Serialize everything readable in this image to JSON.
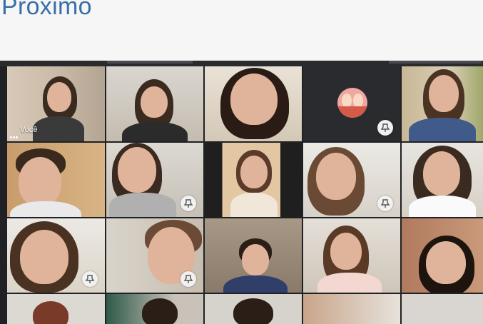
{
  "page": {
    "title": "Próximo"
  },
  "meet": {
    "self_label": "Você",
    "tiles": [
      {
        "id": "r1c1",
        "self": true
      },
      {
        "id": "r1c2"
      },
      {
        "id": "r1c3"
      },
      {
        "id": "r1c4",
        "avatar_only": true
      },
      {
        "id": "r1c5"
      },
      {
        "id": "r2c1"
      },
      {
        "id": "r2c2"
      },
      {
        "id": "r2c3"
      },
      {
        "id": "r2c4"
      },
      {
        "id": "r2c5"
      },
      {
        "id": "r3c1"
      },
      {
        "id": "r3c2"
      },
      {
        "id": "r3c3"
      },
      {
        "id": "r3c4"
      },
      {
        "id": "r3c5"
      },
      {
        "id": "r4c1"
      },
      {
        "id": "r4c2"
      },
      {
        "id": "r4c3"
      },
      {
        "id": "r4c4"
      },
      {
        "id": "r4c5"
      }
    ]
  },
  "icons": {
    "pin": "pin-icon",
    "more": "more-options-icon"
  },
  "colors": {
    "title": "#3a6ea8",
    "frame_bg": "#202124",
    "self_outline": "#7fb6c9"
  }
}
